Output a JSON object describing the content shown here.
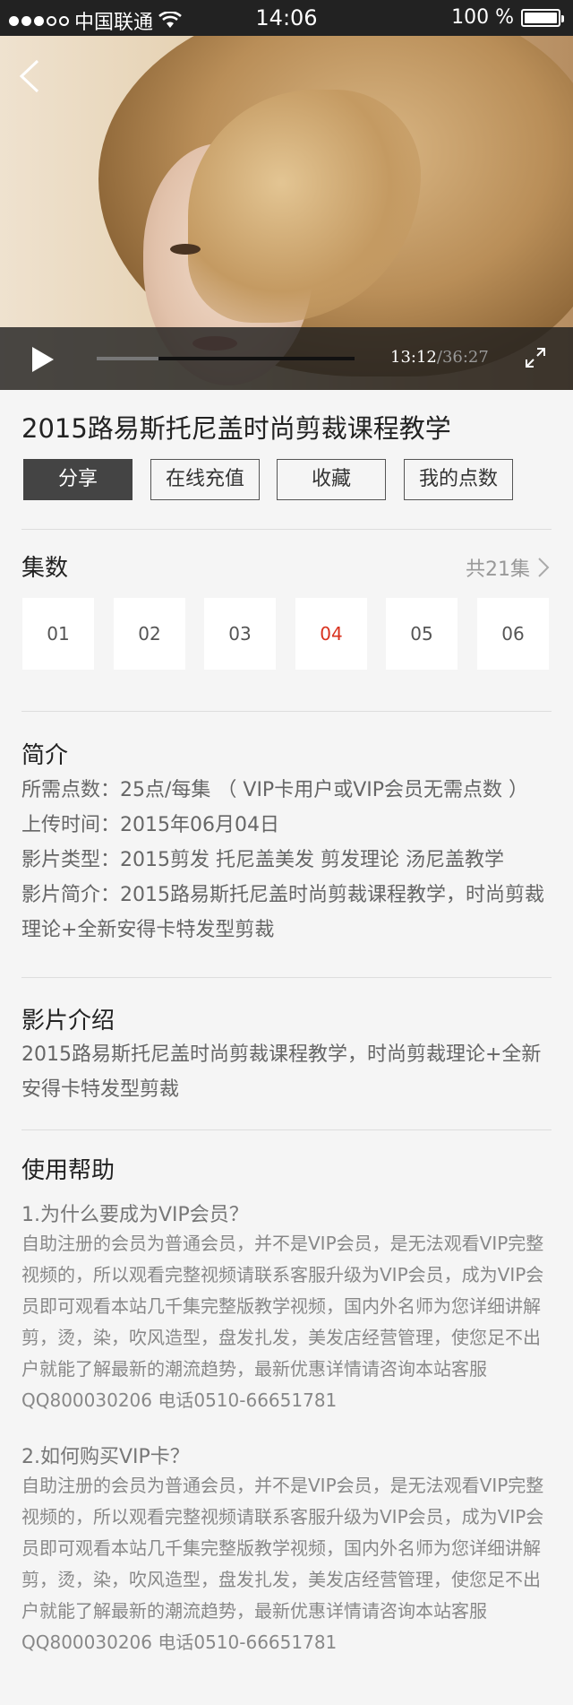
{
  "status_bar": {
    "carrier": "中国联通",
    "time": "14:06",
    "battery": "100 %"
  },
  "player": {
    "current_time": "13:12",
    "separator": "/",
    "total_time": "36:27",
    "progress": 0.24
  },
  "video": {
    "title": "2015路易斯托尼盖时尚剪裁课程教学"
  },
  "actions": [
    {
      "label": "分享",
      "active": true
    },
    {
      "label": "在线充值",
      "active": false
    },
    {
      "label": "收藏",
      "active": false
    },
    {
      "label": "我的点数",
      "active": false
    }
  ],
  "episodes": {
    "heading": "集数",
    "total_label": "共21集",
    "items": [
      "01",
      "02",
      "03",
      "04",
      "05",
      "06"
    ],
    "current": "04"
  },
  "intro": {
    "heading": "简介",
    "points_required": "所需点数：25点/每集 （ VIP卡用户或VIP会员无需点数 ）",
    "upload_time": "上传时间：2015年06月04日",
    "film_type": "影片类型：2015剪发 托尼盖美发 剪发理论 汤尼盖教学",
    "film_summary": "影片简介：2015路易斯托尼盖时尚剪裁课程教学，时尚剪裁理论+全新安得卡特发型剪裁"
  },
  "film_intro": {
    "heading": "影片介绍",
    "text": "2015路易斯托尼盖时尚剪裁课程教学，时尚剪裁理论+全新安得卡特发型剪裁"
  },
  "help": {
    "heading": "使用帮助",
    "items": [
      {
        "question": "1.为什么要成为VIP会员？",
        "answer": "自助注册的会员为普通会员，并不是VIP会员，是无法观看VIP完整视频的，所以观看完整视频请联系客服升级为VIP会员，成为VIP会员即可观看本站几千集完整版教学视频，国内外名师为您详细讲解剪，烫，染，吹风造型，盘发扎发，美发店经营管理，使您足不出户就能了解最新的潮流趋势，最新优惠详情请咨询本站客服QQ800030206 电话0510-66651781"
      },
      {
        "question": "2.如何购买VIP卡？",
        "answer": "自助注册的会员为普通会员，并不是VIP会员，是无法观看VIP完整视频的，所以观看完整视频请联系客服升级为VIP会员，成为VIP会员即可观看本站几千集完整版教学视频，国内外名师为您详细讲解剪，烫，染，吹风造型，盘发扎发，美发店经营管理，使您足不出户就能了解最新的潮流趋势，最新优惠详情请咨询本站客服QQ800030206 电话0510-66651781"
      }
    ]
  },
  "icons": {
    "back": "chevron-left-icon",
    "play": "play-icon",
    "fullscreen": "fullscreen-icon",
    "episodes_more": "chevron-right-icon",
    "wifi": "wifi-icon",
    "signal": "signal-dots-icon",
    "battery": "battery-icon"
  },
  "colors": {
    "accent_red": "#d9321f",
    "dark_button": "#444444",
    "background": "#f5f5f5"
  }
}
